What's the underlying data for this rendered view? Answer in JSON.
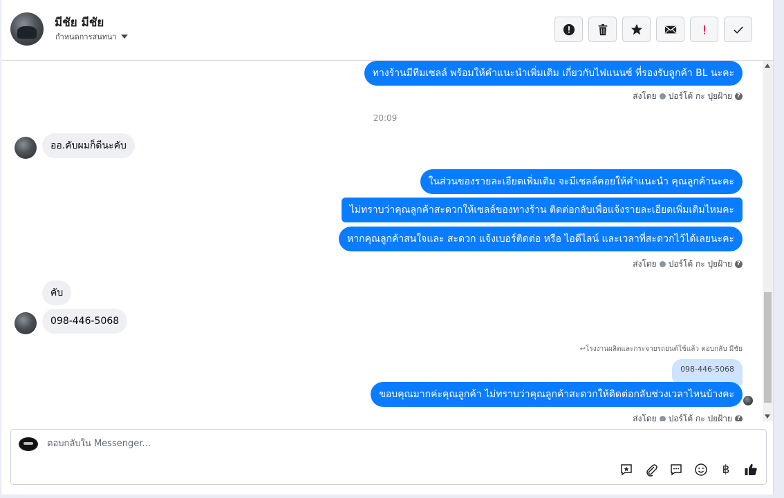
{
  "header": {
    "name": "มีชัย มีชัย",
    "assign_label": "กำหนดการสนทนา"
  },
  "toolbar": {
    "buttons": [
      "info-icon",
      "trash-icon",
      "star-icon",
      "mail-icon",
      "exclamation-icon",
      "check-icon"
    ]
  },
  "messages": {
    "m1": "ทางร้านมีทีมเซลล์ พร้อมให้คำแนะนำเพิ่มเติม เกี่ยวกับไฟแนนซ์ ที่รองรับลูกค้า BL นะคะ",
    "sent1": "ส่งโดย",
    "sender1": "ปอร์โต้ กะ ปุยฝ้าย",
    "time": "20:09",
    "in1": "ออ.คับผมก็ดีนะคับ",
    "m2": "ในส่วนของรายละเอียดเพิ่มเติม จะมีเซลล์คอยให้คำแนะนำ คุณลูกค้านะคะ",
    "m3": "ไม่ทราบว่าคุณลูกค้าสะดวกให้เซลล์ของทางร้าน ติดต่อกลับเพื่อแจ้งรายละเอียดเพิ่มเติมไหมคะ",
    "m4": "หากคุณลูกค้าสนใจและ สะดวก แจ้งเบอร์ติดต่อ หรือ ไอดีไลน์ และเวลาที่สะดวกไว้ได้เลยนะคะ",
    "sent2": "ส่งโดย",
    "sender2": "ปอร์โต้ กะ ปุยฝ้าย",
    "in2": "คับ",
    "in3": "098-446-5068",
    "reply_note": "โรงงานผลิตและกระจายรถยนต์ใช้แล้ว ตอบกลับ มีชัย",
    "quoted": "098-446-5068",
    "m5": "ขอบคุณมากค่ะคุณลูกค้า ไม่ทราบว่าคุณลูกค้าสะดวกให้ติดต่อกลับช่วงเวลาไหนบ้างคะ",
    "sent3": "ส่งโดย",
    "sender3": "ปอร์โต้ กะ ปุยฝ้าย"
  },
  "composer": {
    "placeholder": "ตอบกลับใน Messenger...",
    "baht_symbol": "฿"
  },
  "colors": {
    "accent": "#0a7cff",
    "incoming": "#eef0f3"
  }
}
